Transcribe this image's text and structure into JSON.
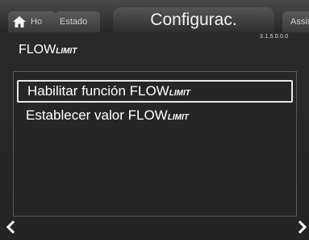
{
  "tabs": {
    "home_label": "Ho",
    "estado_label": "Estado",
    "active_label": "Configurac.",
    "assist_label": "Assis"
  },
  "version": "3.1.5.0.0.0",
  "page_title": {
    "prefix": "FLOW",
    "suffix": "LIMIT"
  },
  "menu": {
    "items": [
      {
        "prefix": "Habilitar función FLOW",
        "suffix": "LIMIT",
        "selected": true
      },
      {
        "prefix": "Establecer valor FLOW",
        "suffix": "LIMIT",
        "selected": false
      }
    ]
  },
  "icons": {
    "home": "home-icon",
    "left": "chevron-left-icon",
    "right": "chevron-right-icon"
  },
  "colors": {
    "background": "#242424",
    "selection_border": "#e8e8e8",
    "text": "#ffffff"
  }
}
